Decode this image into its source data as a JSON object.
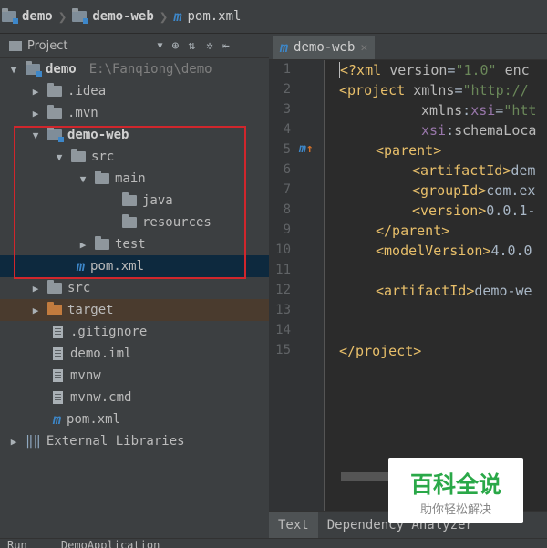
{
  "breadcrumb": [
    {
      "label": "demo",
      "icon": "folder-module-icon"
    },
    {
      "label": "demo-web",
      "icon": "folder-module-icon"
    },
    {
      "label": "pom.xml",
      "icon": "maven-icon"
    }
  ],
  "project_panel": {
    "view_label": "Project"
  },
  "tree": {
    "root": {
      "name": "demo",
      "path": "E:\\Fanqiong\\demo"
    },
    "idea": ".idea",
    "mvn": ".mvn",
    "demo_web": "demo-web",
    "src": "src",
    "main": "main",
    "java": "java",
    "resources": "resources",
    "test": "test",
    "web_pom": "pom.xml",
    "src2": "src",
    "target": "target",
    "gitignore": ".gitignore",
    "demo_iml": "demo.iml",
    "mvnw": "mvnw",
    "mvnw_cmd": "mvnw.cmd",
    "root_pom": "pom.xml",
    "external": "External Libraries"
  },
  "editor": {
    "tab_label": "demo-web",
    "line_numbers": [
      "1",
      "2",
      "3",
      "4",
      "5",
      "6",
      "7",
      "8",
      "9",
      "10",
      "11",
      "12",
      "13",
      "14",
      "15"
    ]
  },
  "bottom_tabs": {
    "text": "Text",
    "dependency": "Dependency Analyzer"
  },
  "run_bar": {
    "label": "Run",
    "app": "DemoApplication"
  },
  "watermark": {
    "title": "百科全说",
    "subtitle": "助你轻松解决"
  },
  "colors": {
    "highlight_border": "#d0262c",
    "selection": "#0d293e",
    "xml_tag": "#e8bf6a",
    "xml_value": "#6a8759"
  }
}
